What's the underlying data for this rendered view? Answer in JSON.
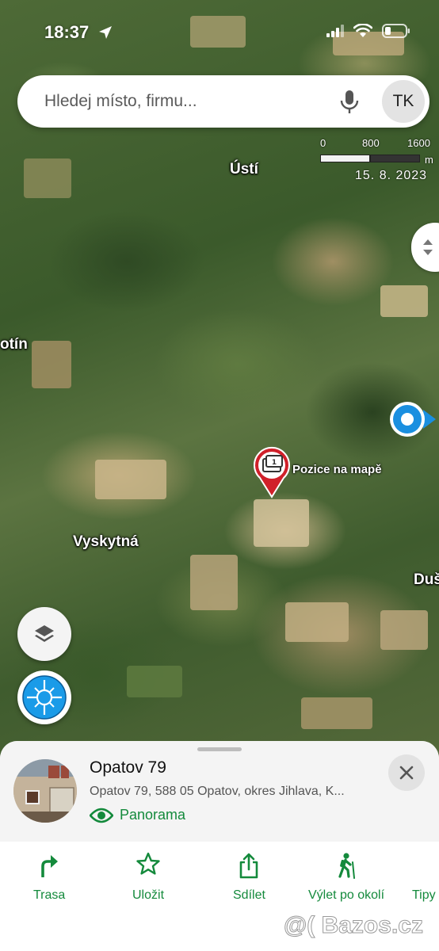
{
  "status_bar": {
    "time": "18:37"
  },
  "search": {
    "placeholder": "Hledej místo, firmu...",
    "avatar_initials": "TK"
  },
  "scale": {
    "ticks": [
      "0",
      "800",
      "1600"
    ],
    "unit": "m",
    "imagery_date": "15. 8. 2023"
  },
  "map": {
    "places": {
      "usti": "Ústí",
      "kotin": "otín",
      "vyskytna": "Vyskytná",
      "dus": "Duš"
    },
    "pin_label": "Pozice na mapě",
    "pin_color": "#d0202a",
    "location_color": "#1a8fe0"
  },
  "place": {
    "title": "Opatov 79",
    "address": "Opatov 79, 588 05 Opatov, okres Jihlava, K...",
    "panorama_label": "Panorama"
  },
  "actions": [
    {
      "label": "Trasa",
      "icon": "route-arrow-icon"
    },
    {
      "label": "Uložit",
      "icon": "star-icon"
    },
    {
      "label": "Sdílet",
      "icon": "share-icon"
    },
    {
      "label": "Výlet po okolí",
      "icon": "hiker-icon"
    },
    {
      "label": "Tipy",
      "icon": "tips-icon"
    }
  ],
  "accent_color": "#148a3c",
  "watermark": "@( Bazos.cz"
}
